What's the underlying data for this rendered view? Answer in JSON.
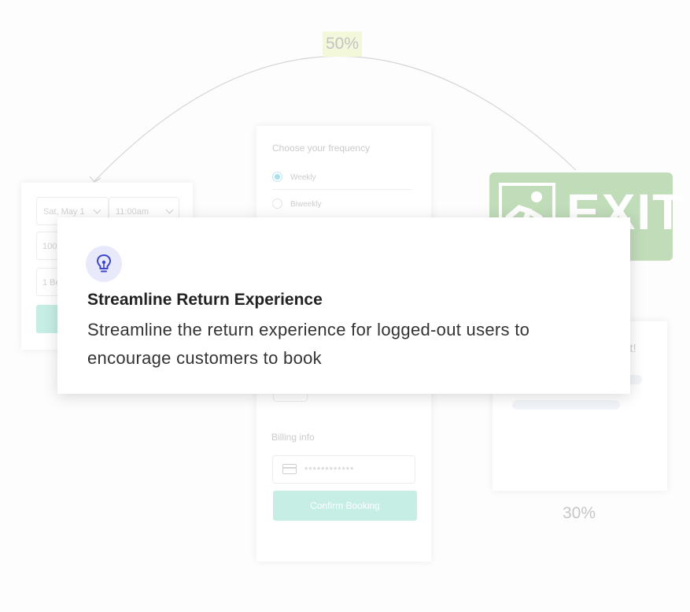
{
  "flow": {
    "top_percent": "50%",
    "bottom_percent": "30%"
  },
  "left_card": {
    "date_value": "Sat, May 1",
    "time_value": "11:00am",
    "field2_partial": "100",
    "field3_partial": "1 Be"
  },
  "center_card": {
    "frequency_title": "Choose your frequency",
    "options": [
      "Weekly",
      "Biweekly"
    ],
    "selected_option": "Weekly",
    "billing_label": "Billing info",
    "card_number_masked": "************",
    "confirm_label": "Confirm Booking"
  },
  "exit_sign": {
    "text": "EXIT"
  },
  "right_card": {
    "title_partial": "et!"
  },
  "tooltip": {
    "icon": "lightbulb-icon",
    "title": "Streamline Return Experience",
    "body": "Streamline the return experience for logged-out users to encourage customers to book"
  },
  "colors": {
    "accent_mint": "#c6eee5",
    "exit_green": "#c0dcb9",
    "icon_bg": "#e8eafb",
    "icon_fg": "#3f46c8",
    "percent_highlight": "#f3f8da"
  }
}
